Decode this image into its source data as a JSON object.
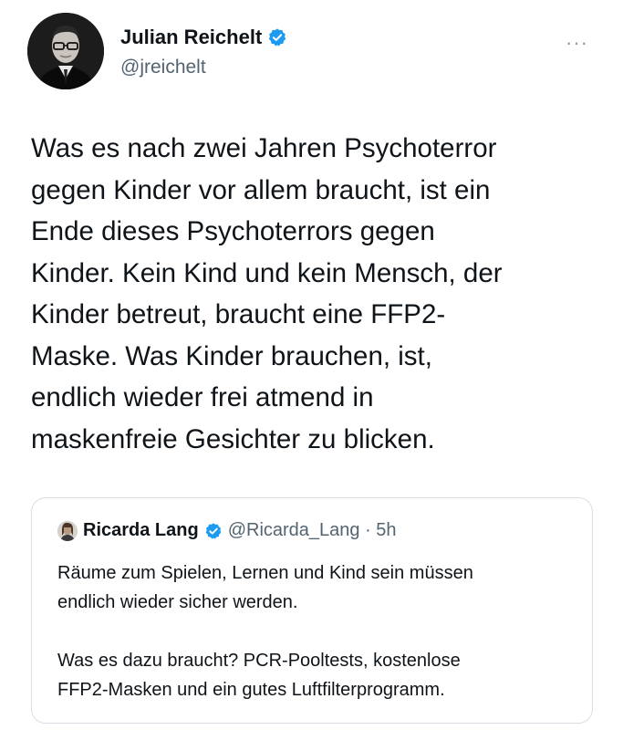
{
  "tweet": {
    "author": {
      "display_name": "Julian Reichelt",
      "handle": "@jreichelt",
      "verified": true
    },
    "more_label": "···",
    "text": "Was es nach zwei Jahren Psychoterror\ngegen Kinder vor allem braucht, ist ein\nEnde dieses Psychoterrors gegen\nKinder. Kein Kind und kein Mensch, der\nKinder betreut, braucht eine FFP2-\nMaske. Was Kinder brauchen, ist,\nendlich wieder frei atmend in\nmaskenfreie Gesichter zu blicken.",
    "quoted": {
      "display_name": "Ricarda Lang",
      "handle_time": "@Ricarda_Lang · 5h",
      "verified": true,
      "text": "Räume zum Spielen, Lernen und Kind sein müssen\nendlich wieder sicher werden.\n\nWas es dazu braucht? PCR-Pooltests, kostenlose\nFFP2-Masken und ein gutes Luftfilterprogramm."
    }
  },
  "colors": {
    "verified_blue": "#1d9bf0",
    "text": "#0f1419",
    "secondary": "#536471",
    "border": "#d8dee3"
  }
}
